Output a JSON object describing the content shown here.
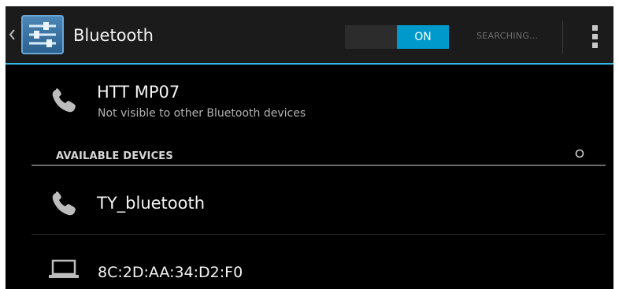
{
  "action_bar": {
    "title": "Bluetooth",
    "app_icon": "settings-sliders-icon",
    "up_icon": "chevron-left-icon",
    "toggle": {
      "on_label": "ON",
      "state": "on"
    },
    "status": "SEARCHING...",
    "overflow_icon": "overflow-menu-icon"
  },
  "paired_device": {
    "name": "HTT MP07",
    "subtitle": "Not visible to other Bluetooth devices",
    "icon": "phone-icon"
  },
  "available_section": {
    "header": "AVAILABLE DEVICES",
    "progress_icon": "spinner-icon",
    "devices": [
      {
        "name": "TY_bluetooth",
        "icon": "phone-icon"
      },
      {
        "name": "8C:2D:AA:34:D2:F0",
        "icon": "laptop-icon"
      }
    ]
  },
  "colors": {
    "accent": "#33b5e5",
    "toggle_on": "#0099cc",
    "background": "#000000",
    "action_bar": "#1b1b1b"
  }
}
